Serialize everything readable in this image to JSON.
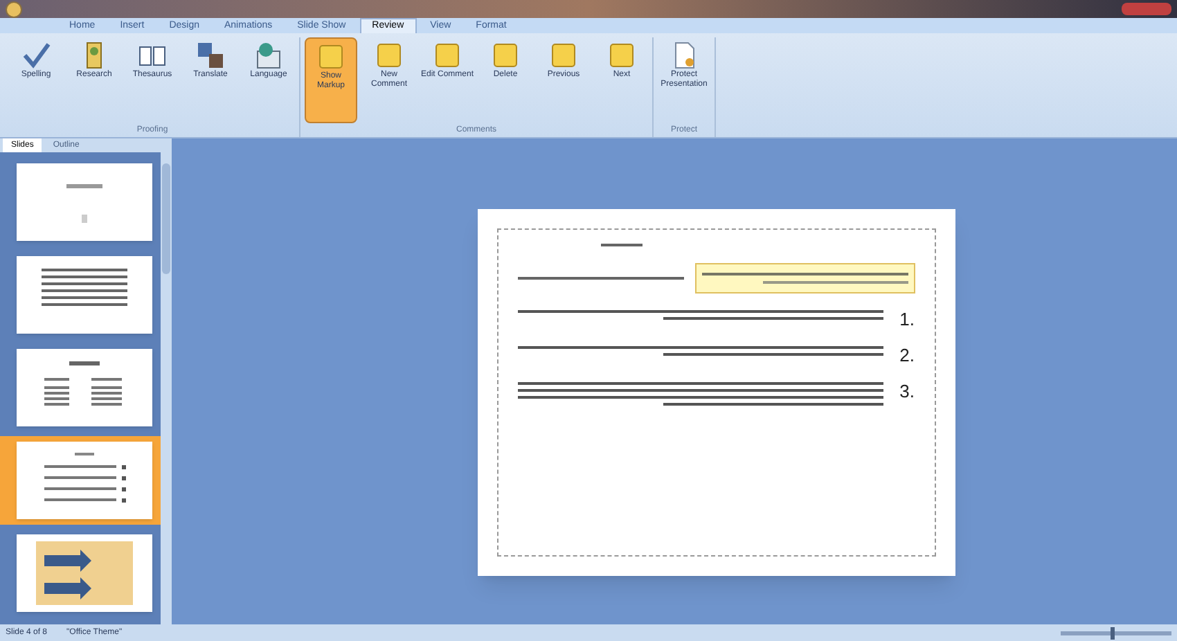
{
  "ribbon_tabs": [
    {
      "label": "Home",
      "selected": false
    },
    {
      "label": "Insert",
      "selected": false
    },
    {
      "label": "Design",
      "selected": false
    },
    {
      "label": "Animations",
      "selected": false
    },
    {
      "label": "Slide Show",
      "selected": false
    },
    {
      "label": "Review",
      "selected": true
    },
    {
      "label": "View",
      "selected": false
    },
    {
      "label": "Format",
      "selected": false
    }
  ],
  "ribbon_groups": [
    {
      "label": "Proofing",
      "buttons": [
        {
          "label": "Spelling",
          "kind": "check",
          "selected": false
        },
        {
          "label": "Research",
          "kind": "book",
          "selected": false
        },
        {
          "label": "Thesaurus",
          "kind": "open-book",
          "selected": false
        },
        {
          "label": "Translate",
          "kind": "translate",
          "selected": false
        },
        {
          "label": "Language",
          "kind": "globe",
          "selected": false
        }
      ]
    },
    {
      "label": "Comments",
      "buttons": [
        {
          "label": "Show Markup",
          "kind": "note",
          "selected": true
        },
        {
          "label": "New Comment",
          "kind": "note",
          "selected": false
        },
        {
          "label": "Edit Comment",
          "kind": "note",
          "selected": false
        },
        {
          "label": "Delete",
          "kind": "note",
          "selected": false
        },
        {
          "label": "Previous",
          "kind": "note",
          "selected": false
        },
        {
          "label": "Next",
          "kind": "note",
          "selected": false
        }
      ]
    },
    {
      "label": "Protect",
      "buttons": [
        {
          "label": "Protect Presentation",
          "kind": "doc",
          "selected": false
        }
      ]
    }
  ],
  "panel_tabs": [
    {
      "label": "Slides",
      "selected": true
    },
    {
      "label": "Outline",
      "selected": false
    }
  ],
  "thumbnails": [
    {
      "kind": "title",
      "selected": false
    },
    {
      "kind": "text",
      "selected": false
    },
    {
      "kind": "columns",
      "selected": false
    },
    {
      "kind": "list",
      "selected": true
    },
    {
      "kind": "arrows",
      "selected": false
    }
  ],
  "slide": {
    "items": [
      {
        "number": "1."
      },
      {
        "number": "2."
      },
      {
        "number": "3."
      }
    ]
  },
  "zoom": {
    "level": 0.45
  },
  "status_bar": {
    "slide": "Slide 4 of 8",
    "theme": "\"Office Theme\""
  }
}
